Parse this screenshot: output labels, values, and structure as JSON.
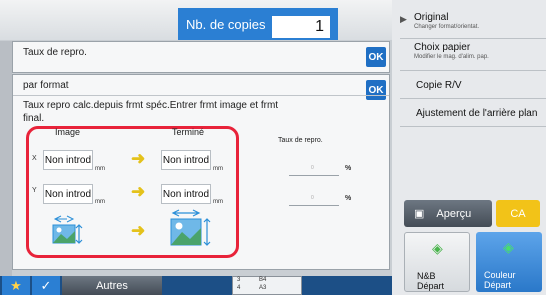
{
  "header": {
    "copies_label": "Nb. de copies",
    "copies_value": "1"
  },
  "panel_repro": {
    "title": "Taux de repro.",
    "ok_label": "OK"
  },
  "panel_format": {
    "title": "par format",
    "ok_label": "OK",
    "description": "Taux repro calc.depuis frmt spéc.Entrer frmt image et frmt final.",
    "col_image": "Image",
    "col_final": "Terminé",
    "x_label": "X",
    "y_label": "Y",
    "x_image_value": "Non introd",
    "x_final_value": "Non introd",
    "y_image_value": "Non introd",
    "y_final_value": "Non introd",
    "unit": "mm",
    "ratio_label": "Taux de repro.",
    "ratio_x_value": "0",
    "ratio_y_value": "0",
    "percent": "%"
  },
  "right_panel": {
    "items": [
      {
        "label": "Original",
        "sub": "Changer format/orientat."
      },
      {
        "label": "Choix papier",
        "sub": "Modifier le mag. d'alim. pap."
      },
      {
        "label": "Copie R/V",
        "sub": ""
      },
      {
        "label": "Ajustement de l'arrière plan",
        "sub": ""
      }
    ],
    "preview_label": "Aperçu",
    "ca_label": "CA",
    "bw_label": "N&B",
    "bw_sub": "Départ",
    "color_label": "Couleur",
    "color_sub": "Départ"
  },
  "bottom": {
    "others_label": "Autres",
    "tray_rows": [
      {
        "num": "3",
        "size": "B4"
      },
      {
        "num": "4",
        "size": "A3"
      }
    ]
  },
  "colors": {
    "accent_blue": "#1f6fc4",
    "highlight_red": "#e8233a",
    "arrow_yellow": "#e4c21b",
    "start_green": "#48b44a"
  }
}
